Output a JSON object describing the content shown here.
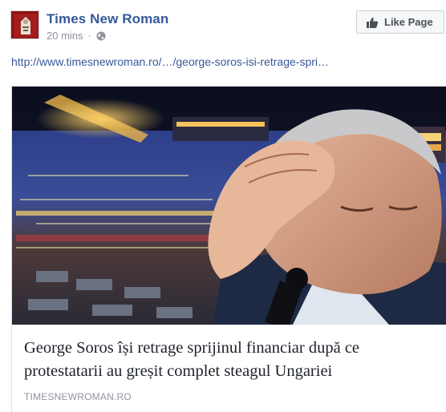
{
  "post": {
    "page_name": "Times New Roman",
    "timestamp": "20 mins",
    "separator": "·",
    "privacy_icon": "globe-icon",
    "like_button_label": "Like Page",
    "like_icon": "thumbs-up-icon",
    "link_url": "http://www.timesnewroman.ro/…/george-soros-isi-retrage-spri…"
  },
  "card": {
    "title": "George Soros își retrage sprijinul financiar după ce protestatarii au greșit complet steagul Ungariei",
    "domain": "TIMESNEWROMAN.RO"
  },
  "colors": {
    "link_blue": "#365899",
    "meta_gray": "#90949c",
    "avatar_red": "#7a1010"
  }
}
